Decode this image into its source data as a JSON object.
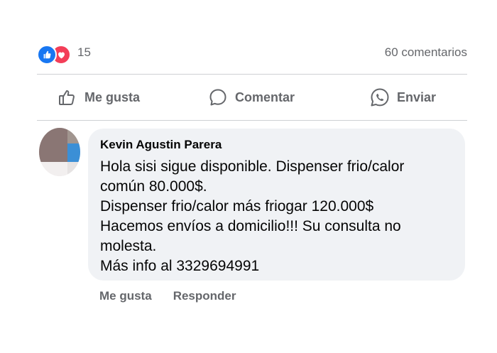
{
  "post_footer": {
    "reaction_count": "15",
    "comments_count": "60 comentarios",
    "reaction_icons": [
      "like-icon",
      "love-icon"
    ],
    "actions": {
      "like_label": "Me gusta",
      "comment_label": "Comentar",
      "send_label": "Enviar"
    }
  },
  "comment": {
    "author": "Kevin Agustin Parera",
    "lines": [
      "Hola sisi sigue disponible. Dispenser frio/calor",
      "común 80.000$.",
      "Dispenser frio/calor más friogar 120.000$",
      "Hacemos envíos a domicilio!!! Su consulta no",
      "molesta.",
      "Más info al 3329694991"
    ],
    "actions": {
      "like_label": "Me gusta",
      "reply_label": "Responder"
    }
  },
  "colors": {
    "accent_blue": "#1877f2",
    "love_red": "#f33e58",
    "secondary_text": "#65676b",
    "bubble_bg": "#f0f2f5"
  }
}
